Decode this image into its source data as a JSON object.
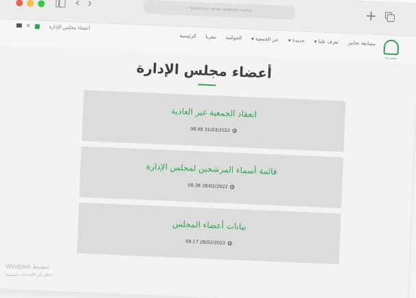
{
  "browser": {
    "address_placeholder": "Search or enter website name",
    "plus_glyph": "+"
  },
  "header": {
    "left_link": "أعضاء مجلس الإدارة",
    "nav": [
      "الرئيسية",
      "مقرنا",
      "الحوكمة",
      "عن الجمعية",
      "جديدنا",
      "تعرف علنا",
      "مسابقة تحابير"
    ],
    "logo_caption": "جمعية دواء"
  },
  "main": {
    "title": "أعضاء مجلس الإدارة",
    "cards": [
      {
        "title": "انعقاد الجمعية غير العادية",
        "datetime": "08.48 31/03/2022"
      },
      {
        "title": "قائمة أسماء المرشحين لمجلس الإدارة",
        "datetime": "09.36 28/02/2022"
      },
      {
        "title": "بيانات أعضاء المجلس",
        "datetime": "09.17 28/02/2022"
      }
    ]
  },
  "watermark": {
    "title": "Windows تنشيط",
    "subtitle": "انتقل إلى الإعدادات لتنشيط"
  },
  "colors": {
    "accent": "#2aa64f",
    "card_bg": "#dcdcdc",
    "traffic_red": "#f25f58",
    "traffic_yellow": "#f6be3b",
    "traffic_green": "#36c84b"
  }
}
